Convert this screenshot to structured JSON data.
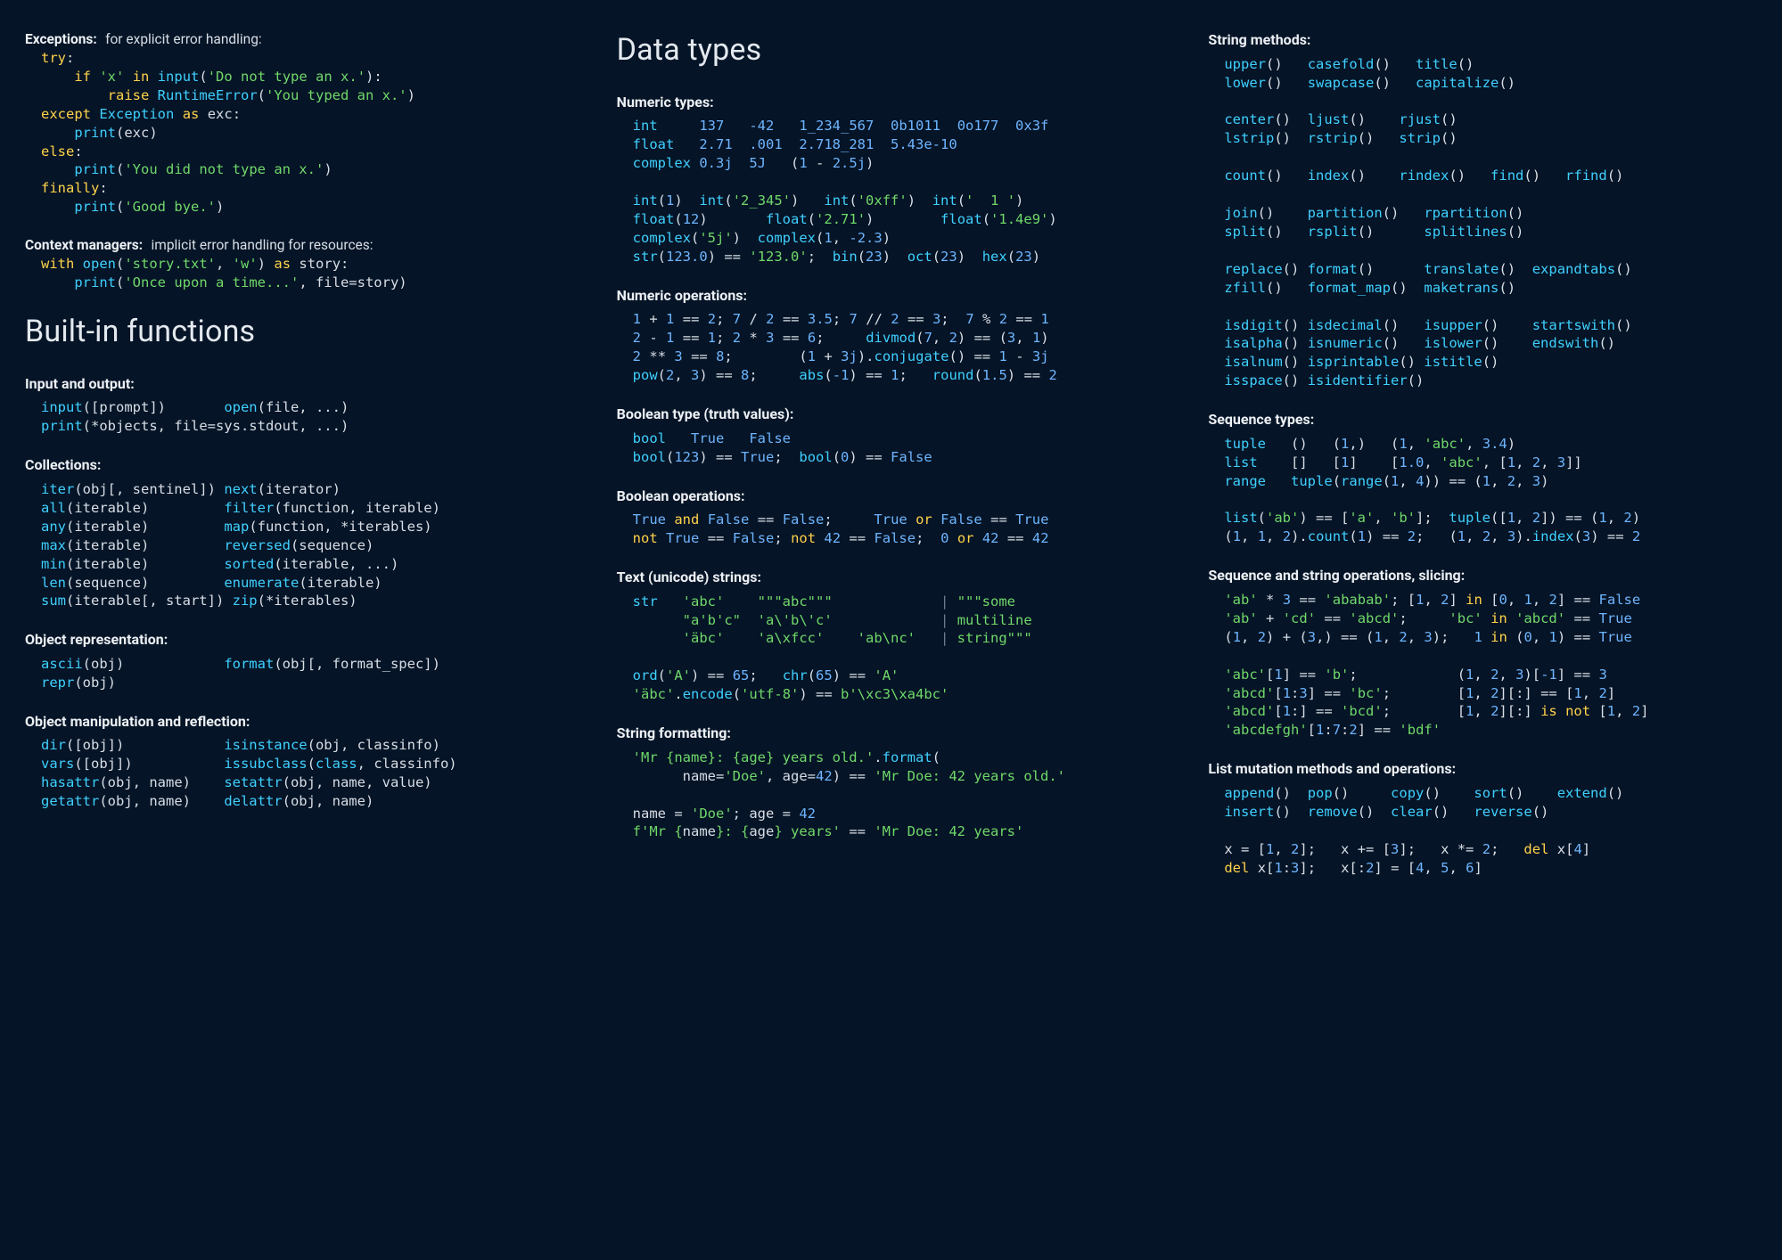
{
  "col1": {
    "sections": [
      {
        "label": "Exceptions:",
        "desc": "for explicit error handling:",
        "code": "<span class=k>try</span><span class=p>:</span>\n    <span class=k>if</span> <span class=s>'x'</span> <span class=k>in</span> <span class=f>input</span><span class=p>(</span><span class=s>'Do not type an x.'</span><span class=p>):</span>\n        <span class=k>raise</span> <span class=f>RuntimeError</span><span class=p>(</span><span class=s>'You typed an x.'</span><span class=p>)</span>\n<span class=k>except</span> <span class=f>Exception</span> <span class=k>as</span> <span class=p>exc:</span>\n    <span class=f>print</span><span class=p>(exc)</span>\n<span class=k>else</span><span class=p>:</span>\n    <span class=f>print</span><span class=p>(</span><span class=s>'You did not type an x.'</span><span class=p>)</span>\n<span class=k>finally</span><span class=p>:</span>\n    <span class=f>print</span><span class=p>(</span><span class=s>'Good bye.'</span><span class=p>)</span>"
      },
      {
        "label": "Context managers:",
        "desc": "implicit error handling for resources:",
        "code": "<span class=k>with</span> <span class=f>open</span><span class=p>(</span><span class=s>'story.txt'</span><span class=p>, </span><span class=s>'w'</span><span class=p>)</span> <span class=k>as</span> <span class=p>story:</span>\n    <span class=f>print</span><span class=p>(</span><span class=s>'Once upon a time...'</span><span class=p>, file=story)</span>"
      }
    ],
    "heading": "Built-in functions",
    "sections2": [
      {
        "label": "Input and output:",
        "code": "<span class=f>input</span><span class=p>([prompt])       </span><span class=f>open</span><span class=p>(file, ...)</span>\n<span class=f>print</span><span class=p>(*objects, file=sys.stdout, ...)</span>"
      },
      {
        "label": "Collections:",
        "code": "<span class=f>iter</span><span class=p>(obj[, sentinel]) </span><span class=f>next</span><span class=p>(iterator)</span>\n<span class=f>all</span><span class=p>(iterable)         </span><span class=f>filter</span><span class=p>(function, iterable)</span>\n<span class=f>any</span><span class=p>(iterable)         </span><span class=f>map</span><span class=p>(function, *iterables)</span>\n<span class=f>max</span><span class=p>(iterable)         </span><span class=f>reversed</span><span class=p>(sequence)</span>\n<span class=f>min</span><span class=p>(iterable)         </span><span class=f>sorted</span><span class=p>(iterable, ...)</span>\n<span class=f>len</span><span class=p>(sequence)         </span><span class=f>enumerate</span><span class=p>(iterable)</span>\n<span class=f>sum</span><span class=p>(iterable[, start]) </span><span class=f>zip</span><span class=p>(*iterables)</span>"
      },
      {
        "label": "Object representation:",
        "code": "<span class=f>ascii</span><span class=p>(obj)            </span><span class=f>format</span><span class=p>(obj[, format_spec])</span>\n<span class=f>repr</span><span class=p>(obj)</span>"
      },
      {
        "label": "Object manipulation and reflection:",
        "code": "<span class=f>dir</span><span class=p>([obj])            </span><span class=f>isinstance</span><span class=p>(obj, classinfo)</span>\n<span class=f>vars</span><span class=p>([obj])           </span><span class=f>issubclass</span><span class=p>(</span><span class=f>class</span><span class=p>, classinfo)</span>\n<span class=f>hasattr</span><span class=p>(obj, name)    </span><span class=f>setattr</span><span class=p>(obj, name, value)</span>\n<span class=f>getattr</span><span class=p>(obj, name)    </span><span class=f>delattr</span><span class=p>(obj, name)</span>"
      }
    ]
  },
  "col2": {
    "heading": "Data types",
    "sections": [
      {
        "label": "Numeric types:",
        "code": "<span class=f>int</span>     <span class=n>137</span>   <span class=n>-42</span>   <span class=n>1_234_567</span>  <span class=n>0b1011</span>  <span class=n>0o177</span>  <span class=n>0x3f</span>\n<span class=f>float</span>   <span class=n>2.71</span>  <span class=n>.001</span>  <span class=n>2.718_281</span>  <span class=n>5.43e-10</span>\n<span class=f>complex</span> <span class=n>0.3j</span>  <span class=n>5J</span>   <span class=p>(</span><span class=n>1</span><span class=p> - </span><span class=n>2.5j</span><span class=p>)</span>\n\n<span class=f>int</span><span class=p>(</span><span class=n>1</span><span class=p>)  </span><span class=f>int</span><span class=p>(</span><span class=s>'2_345'</span><span class=p>)   </span><span class=f>int</span><span class=p>(</span><span class=s>'0xff'</span><span class=p>)  </span><span class=f>int</span><span class=p>(</span><span class=s>'  1 '</span><span class=p>)</span>\n<span class=f>float</span><span class=p>(</span><span class=n>12</span><span class=p>)       </span><span class=f>float</span><span class=p>(</span><span class=s>'2.71'</span><span class=p>)        </span><span class=f>float</span><span class=p>(</span><span class=s>'1.4e9'</span><span class=p>)</span>\n<span class=f>complex</span><span class=p>(</span><span class=s>'5j'</span><span class=p>)  </span><span class=f>complex</span><span class=p>(</span><span class=n>1</span><span class=p>, </span><span class=n>-2.3</span><span class=p>)</span>\n<span class=f>str</span><span class=p>(</span><span class=n>123.0</span><span class=p>) == </span><span class=s>'123.0'</span><span class=p>;  </span><span class=f>bin</span><span class=p>(</span><span class=n>23</span><span class=p>)  </span><span class=f>oct</span><span class=p>(</span><span class=n>23</span><span class=p>)  </span><span class=f>hex</span><span class=p>(</span><span class=n>23</span><span class=p>)</span>"
      },
      {
        "label": "Numeric operations:",
        "code": "<span class=n>1</span> <span class=p>+</span> <span class=n>1</span> <span class=p>==</span> <span class=n>2</span><span class=p>;</span> <span class=n>7</span> <span class=p>/</span> <span class=n>2</span> <span class=p>==</span> <span class=n>3.5</span><span class=p>;</span> <span class=n>7</span> <span class=p>//</span> <span class=n>2</span> <span class=p>==</span> <span class=n>3</span><span class=p>;</span>  <span class=n>7</span> <span class=p>%</span> <span class=n>2</span> <span class=p>==</span> <span class=n>1</span>\n<span class=n>2</span> <span class=p>-</span> <span class=n>1</span> <span class=p>==</span> <span class=n>1</span><span class=p>;</span> <span class=n>2</span> <span class=p>*</span> <span class=n>3</span> <span class=p>==</span> <span class=n>6</span><span class=p>;</span>     <span class=f>divmod</span><span class=p>(</span><span class=n>7</span><span class=p>, </span><span class=n>2</span><span class=p>) == (</span><span class=n>3</span><span class=p>, </span><span class=n>1</span><span class=p>)</span>\n<span class=n>2</span> <span class=p>**</span> <span class=n>3</span> <span class=p>==</span> <span class=n>8</span><span class=p>;</span>        <span class=p>(</span><span class=n>1</span> <span class=p>+</span> <span class=n>3j</span><span class=p>).</span><span class=f>conjugate</span><span class=p>() ==</span> <span class=n>1</span> <span class=p>-</span> <span class=n>3j</span>\n<span class=f>pow</span><span class=p>(</span><span class=n>2</span><span class=p>, </span><span class=n>3</span><span class=p>) == </span><span class=n>8</span><span class=p>;</span>     <span class=f>abs</span><span class=p>(</span><span class=n>-1</span><span class=p>) == </span><span class=n>1</span><span class=p>;</span>   <span class=f>round</span><span class=p>(</span><span class=n>1.5</span><span class=p>) == </span><span class=n>2</span>"
      },
      {
        "label": "Boolean type (truth values):",
        "code": "<span class=f>bool</span>   <span class=n>True</span>   <span class=n>False</span>\n<span class=f>bool</span><span class=p>(</span><span class=n>123</span><span class=p>) == </span><span class=n>True</span><span class=p>;</span>  <span class=f>bool</span><span class=p>(</span><span class=n>0</span><span class=p>) == </span><span class=n>False</span>"
      },
      {
        "label": "Boolean operations:",
        "code": "<span class=n>True</span> <span class=k>and</span> <span class=n>False</span> <span class=p>==</span> <span class=n>False</span><span class=p>;</span>     <span class=n>True</span> <span class=k>or</span> <span class=n>False</span> <span class=p>==</span> <span class=n>True</span>\n<span class=k>not</span> <span class=n>True</span> <span class=p>==</span> <span class=n>False</span><span class=p>;</span> <span class=k>not</span> <span class=n>42</span> <span class=p>==</span> <span class=n>False</span><span class=p>;</span>  <span class=n>0</span> <span class=k>or</span> <span class=n>42</span> <span class=p>==</span> <span class=n>42</span>"
      },
      {
        "label": "Text (unicode) strings:",
        "code": "<span class=f>str</span>   <span class=s>'abc'</span>    <span class=s>\"\"\"abc\"\"\"</span>             <span class=d>|</span> <span class=s>\"\"\"some</span>\n      <span class=s>\"a'b'c\"</span>  <span class=s>'a\\'b\\'c'</span>             <span class=d>|</span> <span class=s>multiline</span>\n      <span class=s>'äbc'</span>    <span class=s>'a\\xfcc'</span>    <span class=s>'ab\\nc'</span>   <span class=d>|</span> <span class=s>string\"\"\"</span>\n\n<span class=f>ord</span><span class=p>(</span><span class=s>'A'</span><span class=p>) == </span><span class=n>65</span><span class=p>;</span>   <span class=f>chr</span><span class=p>(</span><span class=n>65</span><span class=p>) == </span><span class=s>'A'</span>\n<span class=s>'äbc'</span><span class=p>.</span><span class=f>encode</span><span class=p>(</span><span class=s>'utf-8'</span><span class=p>) == </span><span class=s>b'\\xc3\\xa4bc'</span>"
      },
      {
        "label": "String formatting:",
        "code": "<span class=s>'Mr {name}: {age} years old.'</span><span class=p>.</span><span class=f>format</span><span class=p>(</span>\n      <span class=p>name=</span><span class=s>'Doe'</span><span class=p>, age=</span><span class=n>42</span><span class=p>) == </span><span class=s>'Mr Doe: 42 years old.'</span>\n\n<span class=p>name = </span><span class=s>'Doe'</span><span class=p>; age = </span><span class=n>42</span>\n<span class=s>f'Mr {</span><span class=p>name</span><span class=s>}: {</span><span class=p>age</span><span class=s>} years'</span> <span class=p>==</span> <span class=s>'Mr Doe: 42 years'</span>"
      }
    ]
  },
  "col3": {
    "sections": [
      {
        "label": "String methods:",
        "code": "<span class=f>upper</span><span class=p>()</span>   <span class=f>casefold</span><span class=p>()</span>   <span class=f>title</span><span class=p>()</span>\n<span class=f>lower</span><span class=p>()</span>   <span class=f>swapcase</span><span class=p>()</span>   <span class=f>capitalize</span><span class=p>()</span>\n\n<span class=f>center</span><span class=p>()</span>  <span class=f>ljust</span><span class=p>()</span>    <span class=f>rjust</span><span class=p>()</span>\n<span class=f>lstrip</span><span class=p>()</span>  <span class=f>rstrip</span><span class=p>()</span>   <span class=f>strip</span><span class=p>()</span>\n\n<span class=f>count</span><span class=p>()</span>   <span class=f>index</span><span class=p>()</span>    <span class=f>rindex</span><span class=p>()</span>   <span class=f>find</span><span class=p>()</span>   <span class=f>rfind</span><span class=p>()</span>\n\n<span class=f>join</span><span class=p>()</span>    <span class=f>partition</span><span class=p>()</span>   <span class=f>rpartition</span><span class=p>()</span>\n<span class=f>split</span><span class=p>()</span>   <span class=f>rsplit</span><span class=p>()</span>      <span class=f>splitlines</span><span class=p>()</span>\n\n<span class=f>replace</span><span class=p>()</span> <span class=f>format</span><span class=p>()</span>      <span class=f>translate</span><span class=p>()</span>  <span class=f>expandtabs</span><span class=p>()</span>\n<span class=f>zfill</span><span class=p>()</span>   <span class=f>format_map</span><span class=p>()</span>  <span class=f>maketrans</span><span class=p>()</span>\n\n<span class=f>isdigit</span><span class=p>()</span> <span class=f>isdecimal</span><span class=p>()</span>   <span class=f>isupper</span><span class=p>()</span>    <span class=f>startswith</span><span class=p>()</span>\n<span class=f>isalpha</span><span class=p>()</span> <span class=f>isnumeric</span><span class=p>()</span>   <span class=f>islower</span><span class=p>()</span>    <span class=f>endswith</span><span class=p>()</span>\n<span class=f>isalnum</span><span class=p>()</span> <span class=f>isprintable</span><span class=p>()</span> <span class=f>istitle</span><span class=p>()</span>\n<span class=f>isspace</span><span class=p>()</span> <span class=f>isidentifier</span><span class=p>()</span>"
      },
      {
        "label": "Sequence types:",
        "code": "<span class=f>tuple</span>   <span class=p>()</span>   <span class=p>(</span><span class=n>1</span><span class=p>,)</span>   <span class=p>(</span><span class=n>1</span><span class=p>, </span><span class=s>'abc'</span><span class=p>, </span><span class=n>3.4</span><span class=p>)</span>\n<span class=f>list</span>    <span class=p>[]</span>   <span class=p>[</span><span class=n>1</span><span class=p>]</span>    <span class=p>[</span><span class=n>1.0</span><span class=p>, </span><span class=s>'abc'</span><span class=p>, [</span><span class=n>1</span><span class=p>, </span><span class=n>2</span><span class=p>, </span><span class=n>3</span><span class=p>]]</span>\n<span class=f>range</span>   <span class=f>tuple</span><span class=p>(</span><span class=f>range</span><span class=p>(</span><span class=n>1</span><span class=p>, </span><span class=n>4</span><span class=p>)) == (</span><span class=n>1</span><span class=p>, </span><span class=n>2</span><span class=p>, </span><span class=n>3</span><span class=p>)</span>\n\n<span class=f>list</span><span class=p>(</span><span class=s>'ab'</span><span class=p>) == [</span><span class=s>'a'</span><span class=p>, </span><span class=s>'b'</span><span class=p>];</span>  <span class=f>tuple</span><span class=p>([</span><span class=n>1</span><span class=p>, </span><span class=n>2</span><span class=p>]) == (</span><span class=n>1</span><span class=p>, </span><span class=n>2</span><span class=p>)</span>\n<span class=p>(</span><span class=n>1</span><span class=p>, </span><span class=n>1</span><span class=p>, </span><span class=n>2</span><span class=p>).</span><span class=f>count</span><span class=p>(</span><span class=n>1</span><span class=p>) == </span><span class=n>2</span><span class=p>;</span>   <span class=p>(</span><span class=n>1</span><span class=p>, </span><span class=n>2</span><span class=p>, </span><span class=n>3</span><span class=p>).</span><span class=f>index</span><span class=p>(</span><span class=n>3</span><span class=p>) == </span><span class=n>2</span>"
      },
      {
        "label": "Sequence and string operations, slicing:",
        "code": "<span class=s>'ab'</span> <span class=p>*</span> <span class=n>3</span> <span class=p>==</span> <span class=s>'ababab'</span><span class=p>;</span> <span class=p>[</span><span class=n>1</span><span class=p>, </span><span class=n>2</span><span class=p>]</span> <span class=k>in</span> <span class=p>[</span><span class=n>0</span><span class=p>, </span><span class=n>1</span><span class=p>, </span><span class=n>2</span><span class=p>] ==</span> <span class=n>False</span>\n<span class=s>'ab'</span> <span class=p>+</span> <span class=s>'cd'</span> <span class=p>==</span> <span class=s>'abcd'</span><span class=p>;</span>     <span class=s>'bc'</span> <span class=k>in</span> <span class=s>'abcd'</span> <span class=p>==</span> <span class=n>True</span>\n<span class=p>(</span><span class=n>1</span><span class=p>, </span><span class=n>2</span><span class=p>) + (</span><span class=n>3</span><span class=p>,) == (</span><span class=n>1</span><span class=p>, </span><span class=n>2</span><span class=p>, </span><span class=n>3</span><span class=p>);</span>   <span class=n>1</span> <span class=k>in</span> <span class=p>(</span><span class=n>0</span><span class=p>, </span><span class=n>1</span><span class=p>) ==</span> <span class=n>True</span>\n\n<span class=s>'abc'</span><span class=p>[</span><span class=n>1</span><span class=p>] == </span><span class=s>'b'</span><span class=p>;</span>            <span class=p>(</span><span class=n>1</span><span class=p>, </span><span class=n>2</span><span class=p>, </span><span class=n>3</span><span class=p>)[</span><span class=n>-1</span><span class=p>] == </span><span class=n>3</span>\n<span class=s>'abcd'</span><span class=p>[</span><span class=n>1</span><span class=p>:</span><span class=n>3</span><span class=p>] == </span><span class=s>'bc'</span><span class=p>;</span>        <span class=p>[</span><span class=n>1</span><span class=p>, </span><span class=n>2</span><span class=p>][:] == [</span><span class=n>1</span><span class=p>, </span><span class=n>2</span><span class=p>]</span>\n<span class=s>'abcd'</span><span class=p>[</span><span class=n>1</span><span class=p>:] == </span><span class=s>'bcd'</span><span class=p>;</span>        <span class=p>[</span><span class=n>1</span><span class=p>, </span><span class=n>2</span><span class=p>][:]</span> <span class=k>is not</span> <span class=p>[</span><span class=n>1</span><span class=p>, </span><span class=n>2</span><span class=p>]</span>\n<span class=s>'abcdefgh'</span><span class=p>[</span><span class=n>1</span><span class=p>:</span><span class=n>7</span><span class=p>:</span><span class=n>2</span><span class=p>] == </span><span class=s>'bdf'</span>"
      },
      {
        "label": "List mutation methods and operations:",
        "code": "<span class=f>append</span><span class=p>()</span>  <span class=f>pop</span><span class=p>()</span>     <span class=f>copy</span><span class=p>()</span>    <span class=f>sort</span><span class=p>()</span>    <span class=f>extend</span><span class=p>()</span>\n<span class=f>insert</span><span class=p>()</span>  <span class=f>remove</span><span class=p>()</span>  <span class=f>clear</span><span class=p>()</span>   <span class=f>reverse</span><span class=p>()</span>\n\n<span class=p>x = [</span><span class=n>1</span><span class=p>, </span><span class=n>2</span><span class=p>];</span>   <span class=p>x += [</span><span class=n>3</span><span class=p>];</span>   <span class=p>x *= </span><span class=n>2</span><span class=p>;</span>   <span class=k>del</span> <span class=p>x[</span><span class=n>4</span><span class=p>]</span>\n<span class=k>del</span> <span class=p>x[</span><span class=n>1</span><span class=p>:</span><span class=n>3</span><span class=p>];</span>   <span class=p>x[:</span><span class=n>2</span><span class=p>] = [</span><span class=n>4</span><span class=p>, </span><span class=n>5</span><span class=p>, </span><span class=n>6</span><span class=p>]</span>"
      }
    ]
  }
}
